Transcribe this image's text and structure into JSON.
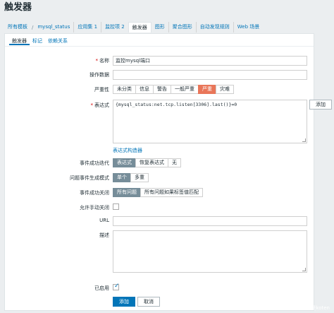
{
  "page": {
    "title": "触发器"
  },
  "breadcrumb": {
    "items": [
      "所有模板",
      "mysql_status"
    ],
    "separator": "/"
  },
  "top_tabs": [
    "应用集 1",
    "监控项 2",
    "触发器",
    "图形",
    "聚合图形",
    "自动发现规则",
    "Web 场景"
  ],
  "sub_tabs": [
    "触发器",
    "标记",
    "依赖关系"
  ],
  "form": {
    "name": {
      "label": "名称",
      "value": "监控mysql端口"
    },
    "opdata": {
      "label": "操作数据",
      "value": ""
    },
    "severity": {
      "label": "严重性",
      "options": [
        "未分类",
        "信息",
        "警告",
        "一般严重",
        "严重",
        "灾难"
      ],
      "selected": "严重"
    },
    "expression": {
      "label": "表达式",
      "value": "{mysql_status:net.tcp.listen[3306].last()}=0",
      "add_button": "添加",
      "builder_link": "表达式构造器"
    },
    "ok_event": {
      "label": "事件成功迭代",
      "options": [
        "表达式",
        "恢复表达式",
        "无"
      ],
      "selected": "表达式"
    },
    "problem_mode": {
      "label": "问题事件生成模式",
      "options": [
        "单个",
        "多重"
      ],
      "selected": "单个"
    },
    "ok_close": {
      "label": "事件成功关闭",
      "options": [
        "所有问题",
        "所有问题如果标签值匹配"
      ],
      "selected": "所有问题"
    },
    "manual_close": {
      "label": "允许手动关闭",
      "checked": false
    },
    "url": {
      "label": "URL",
      "value": ""
    },
    "description": {
      "label": "描述",
      "value": ""
    },
    "enabled": {
      "label": "已启用",
      "checked": true
    },
    "actions": {
      "add": "添加",
      "cancel": "取消"
    }
  },
  "watermark": "CSDN @我是koten",
  "colors": {
    "accent": "#0275b8",
    "severity_high": "#e97659",
    "selected": "#768d99",
    "required": "#d40000"
  }
}
